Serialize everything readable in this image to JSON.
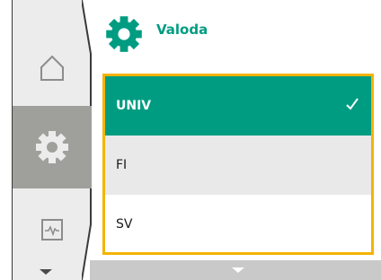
{
  "header": {
    "title": "Valoda",
    "icon": "gear-icon"
  },
  "sidebar": {
    "items": [
      {
        "name": "home",
        "icon": "home-icon"
      },
      {
        "name": "settings",
        "icon": "gear-icon",
        "active": true
      },
      {
        "name": "diagnostics",
        "icon": "diagnostics-icon"
      }
    ]
  },
  "language_list": {
    "items": [
      {
        "label": "UNIV",
        "selected": true
      },
      {
        "label": "FI",
        "selected": false
      },
      {
        "label": "SV",
        "selected": false
      }
    ]
  },
  "colors": {
    "accent": "#009c82",
    "focus_border": "#f5b301",
    "selected_bg": "#009c82",
    "alt_row_bg": "#e9e9e9",
    "active_nav_bg": "#9fa09b"
  }
}
